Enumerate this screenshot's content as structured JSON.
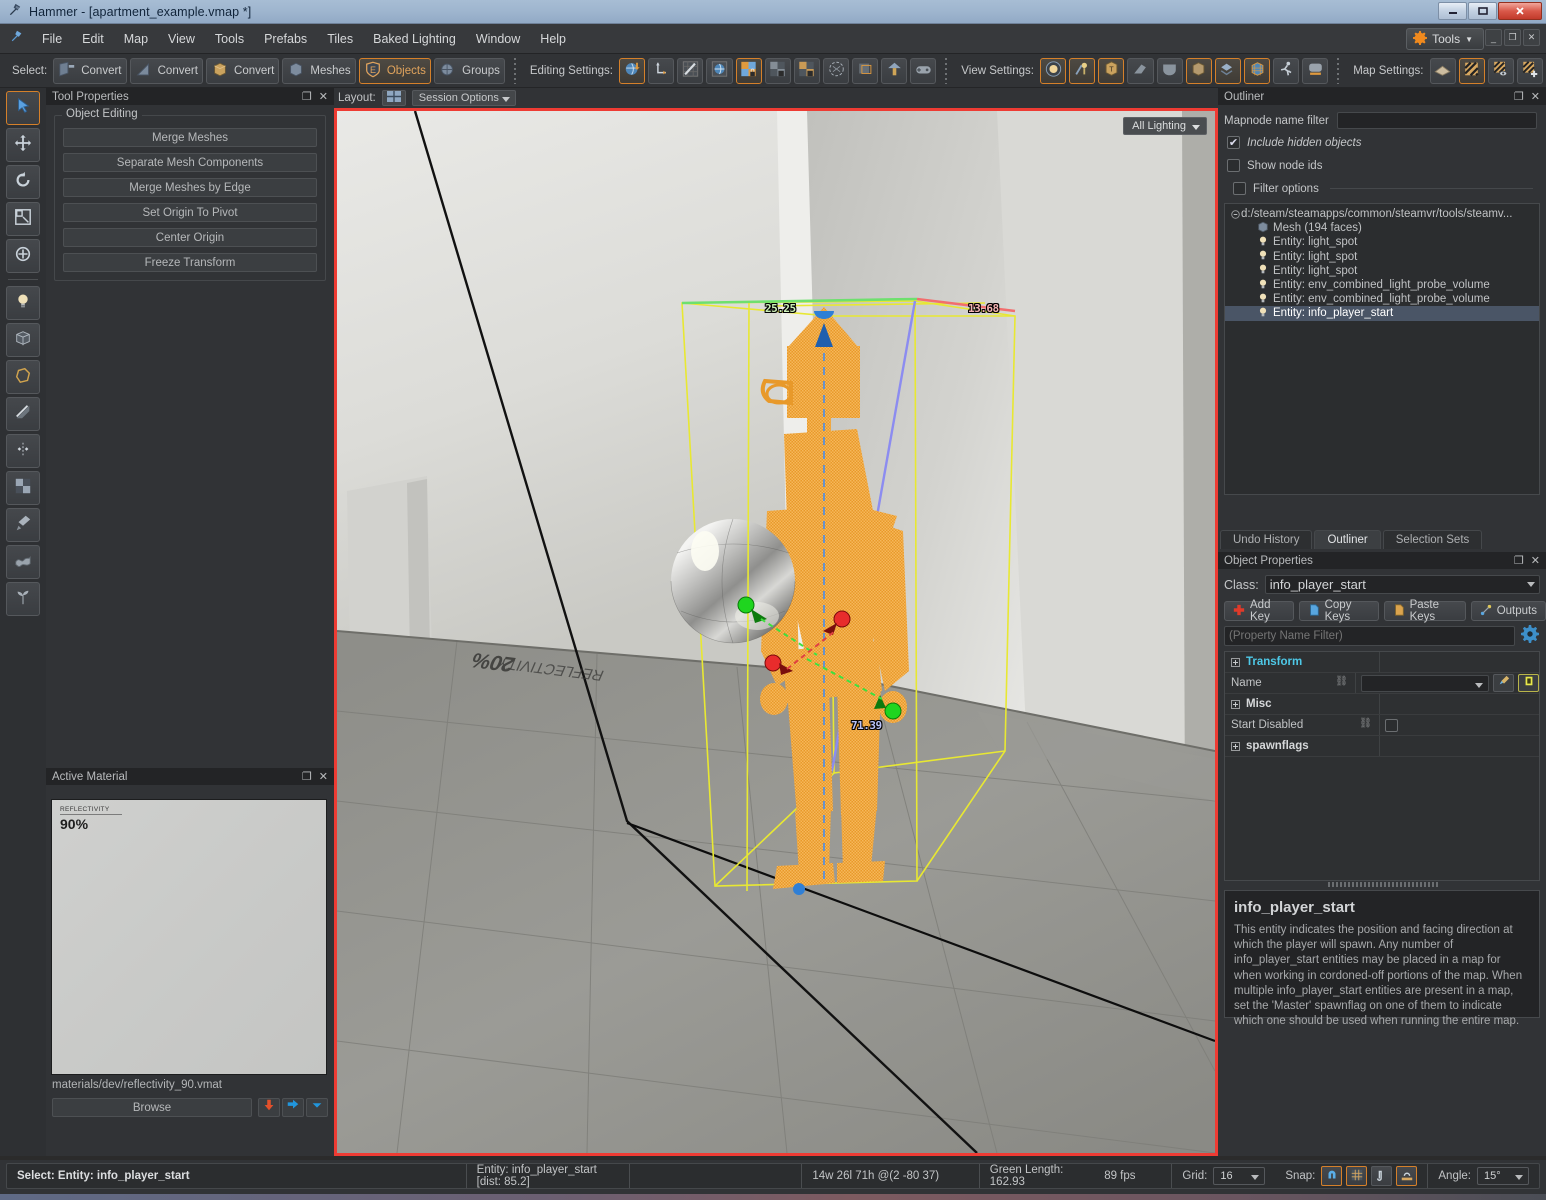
{
  "window": {
    "title": "Hammer - [apartment_example.vmap *]",
    "app_icon": "hammer-icon",
    "minimize": "–",
    "maximize": "❐",
    "close": "✕"
  },
  "menu": {
    "items": [
      "File",
      "Edit",
      "Map",
      "View",
      "Tools",
      "Prefabs",
      "Tiles",
      "Baked Lighting",
      "Window",
      "Help"
    ],
    "tools_button": "Tools",
    "mdi": [
      "–",
      "❐",
      "✕"
    ]
  },
  "toolbar": {
    "select_label": "Select:",
    "select_buttons": [
      {
        "label": "Convert",
        "icon": "convert-face-icon",
        "active": false
      },
      {
        "label": "Convert",
        "icon": "convert-edge-icon",
        "active": false
      },
      {
        "label": "Convert",
        "icon": "convert-vertex-icon",
        "active": false
      },
      {
        "label": "Meshes",
        "icon": "meshes-icon",
        "active": false
      },
      {
        "label": "Objects",
        "icon": "objects-icon",
        "active": true
      },
      {
        "label": "Groups",
        "icon": "groups-icon",
        "active": false
      }
    ],
    "editing_label": "Editing Settings:",
    "editing_buttons": [
      {
        "icon": "world-space-icon",
        "active": true
      },
      {
        "icon": "local-space-icon",
        "active": false
      },
      {
        "icon": "texture-lock-icon",
        "active": false
      },
      {
        "icon": "texture-world-icon",
        "active": false
      },
      {
        "icon": "lock-grid-icon",
        "active": true
      },
      {
        "icon": "lock-alpha-icon",
        "active": false
      },
      {
        "icon": "lock-scale-icon",
        "active": false
      },
      {
        "icon": "collision-icon",
        "active": false
      },
      {
        "icon": "bbox-icon",
        "active": false
      },
      {
        "icon": "tool-brush-icon",
        "active": false
      },
      {
        "icon": "gamepad-icon",
        "active": false
      }
    ],
    "view_label": "View Settings:",
    "view_buttons": [
      {
        "icon": "light-preview-icon",
        "active": true
      },
      {
        "icon": "entity-helpers-icon",
        "active": true
      },
      {
        "icon": "texture-cube-icon",
        "active": true
      },
      {
        "icon": "gizmo-icon",
        "active": false
      },
      {
        "icon": "occluder-icon",
        "active": false
      },
      {
        "icon": "model-box-icon",
        "active": true
      },
      {
        "icon": "layers-icon",
        "active": true
      },
      {
        "icon": "wireframe-icon",
        "active": true
      },
      {
        "icon": "run-icon",
        "active": false
      },
      {
        "icon": "camera-icon",
        "active": false
      }
    ],
    "map_label": "Map Settings:",
    "map_buttons": [
      {
        "icon": "cordon-icon",
        "active": false
      },
      {
        "icon": "nodraw-icon",
        "active": true
      },
      {
        "icon": "hide-hint-icon",
        "active": false
      },
      {
        "icon": "add-visgroup-icon",
        "active": false
      }
    ]
  },
  "vtools": [
    {
      "icon": "arrow-select-icon",
      "active": true
    },
    {
      "icon": "translate-icon",
      "active": false
    },
    {
      "icon": "rotate-icon",
      "active": false
    },
    {
      "icon": "scale-icon",
      "active": false
    },
    {
      "icon": "pivot-icon",
      "active": false
    },
    {
      "icon": "light-bulb-icon",
      "active": false
    },
    {
      "icon": "block-tool-icon",
      "active": false
    },
    {
      "icon": "polygon-tool-icon",
      "active": false
    },
    {
      "icon": "clip-tool-icon",
      "active": false
    },
    {
      "icon": "vertex-tool-icon",
      "active": false
    },
    {
      "icon": "texture-tool-icon",
      "active": false
    },
    {
      "icon": "paint-tool-icon",
      "active": false
    },
    {
      "icon": "displacement-tool-icon",
      "active": false
    },
    {
      "icon": "foliage-tool-icon",
      "active": false
    }
  ],
  "tool_properties": {
    "title": "Tool Properties",
    "group_label": "Object Editing",
    "buttons": [
      "Merge Meshes",
      "Separate Mesh Components",
      "Merge Meshes by Edge",
      "Set Origin To Pivot",
      "Center Origin",
      "Freeze Transform"
    ]
  },
  "active_material": {
    "title": "Active Material",
    "preview_label": "REFLECTIVITY",
    "preview_value": "90%",
    "path": "materials/dev/reflectivity_90.vmat",
    "browse_label": "Browse",
    "icons": [
      "download-arrow-icon",
      "apply-arrow-icon",
      "dropdown-arrow-icon"
    ]
  },
  "viewport": {
    "layout_label": "Layout:",
    "layout_icon": "quad-layout-icon",
    "session_options": "Session Options",
    "lighting_mode": "All Lighting",
    "floor_text_line1": "REFLECTIVITY",
    "floor_text_line2": "20%",
    "measurements": [
      {
        "value": "25.25",
        "color": "#b9f0a8"
      },
      {
        "value": "13.68",
        "color": "#f2a8a8"
      },
      {
        "value": "71.39",
        "color": "#a8b4f2"
      }
    ]
  },
  "outliner": {
    "title": "Outliner",
    "filter_label": "Mapnode name filter",
    "filter_value": "",
    "include_hidden_label": "Include hidden objects",
    "include_hidden_checked": true,
    "show_node_ids_label": "Show node ids",
    "show_node_ids_checked": false,
    "filter_options_label": "Filter options",
    "filter_options_checked": false,
    "root": "d:/steam/steamapps/common/steamvr/tools/steamv...",
    "nodes": [
      {
        "label": "Mesh (194 faces)",
        "icon": "mesh-icon",
        "selected": false
      },
      {
        "label": "Entity: light_spot",
        "icon": "light-icon",
        "selected": false
      },
      {
        "label": "Entity: light_spot",
        "icon": "light-icon",
        "selected": false
      },
      {
        "label": "Entity: light_spot",
        "icon": "light-icon",
        "selected": false
      },
      {
        "label": "Entity: env_combined_light_probe_volume",
        "icon": "light-icon",
        "selected": false
      },
      {
        "label": "Entity: env_combined_light_probe_volume",
        "icon": "light-icon",
        "selected": false
      },
      {
        "label": "Entity: info_player_start",
        "icon": "light-icon",
        "selected": true
      }
    ]
  },
  "dock_tabs": [
    {
      "label": "Undo History",
      "active": false
    },
    {
      "label": "Outliner",
      "active": true
    },
    {
      "label": "Selection Sets",
      "active": false
    }
  ],
  "object_properties": {
    "title": "Object Properties",
    "class_label": "Class:",
    "class_value": "info_player_start",
    "buttons": [
      {
        "label": "Add Key",
        "icon": "add-key-icon"
      },
      {
        "label": "Copy Keys",
        "icon": "copy-keys-icon"
      },
      {
        "label": "Paste Keys",
        "icon": "paste-keys-icon"
      },
      {
        "label": "Outputs",
        "icon": "outputs-icon"
      }
    ],
    "filter_placeholder": "(Property Name Filter)",
    "filter_value": "",
    "gear_icon": "gear-icon",
    "rows": [
      {
        "type": "category",
        "label": "Transform"
      },
      {
        "type": "combo",
        "label": "Name",
        "value": ""
      },
      {
        "type": "category",
        "label": "Misc"
      },
      {
        "type": "checkbox",
        "label": "Start Disabled",
        "checked": false
      },
      {
        "type": "category",
        "label": "spawnflags"
      }
    ],
    "help_title": "info_player_start",
    "help_body": "This entity indicates the position and facing direction at which the player will spawn. Any number of info_player_start entities may be placed in a map for when working in cordoned-off portions of the map. When multiple info_player_start entities are present in a map, set the 'Master' spawnflag on one of them to indicate which one should be used when running the entire map."
  },
  "statusbar": {
    "select_text": "Select: Entity: info_player_start",
    "entity_text": "Entity: info_player_start   [dist: 85.2]",
    "coords_text": "14w 26l 71h @(2 -80 37)",
    "green_length": "Green Length: 162.93",
    "fps": "89 fps",
    "grid_label": "Grid:",
    "grid_value": "16",
    "snap_label": "Snap:",
    "snap_buttons": [
      {
        "icon": "magnet-icon",
        "active": true
      },
      {
        "icon": "snap-grid-icon",
        "active": true
      },
      {
        "icon": "snap-vertex-icon",
        "active": false
      },
      {
        "icon": "snap-surface-icon",
        "active": true
      }
    ],
    "angle_label": "Angle:",
    "angle_value": "15°"
  },
  "colors": {
    "accent": "#d5802a",
    "viewport_border": "#ee3b33",
    "selection": "#4a5566",
    "category": "#4ec9e8",
    "model_orange": "#f0a030"
  }
}
